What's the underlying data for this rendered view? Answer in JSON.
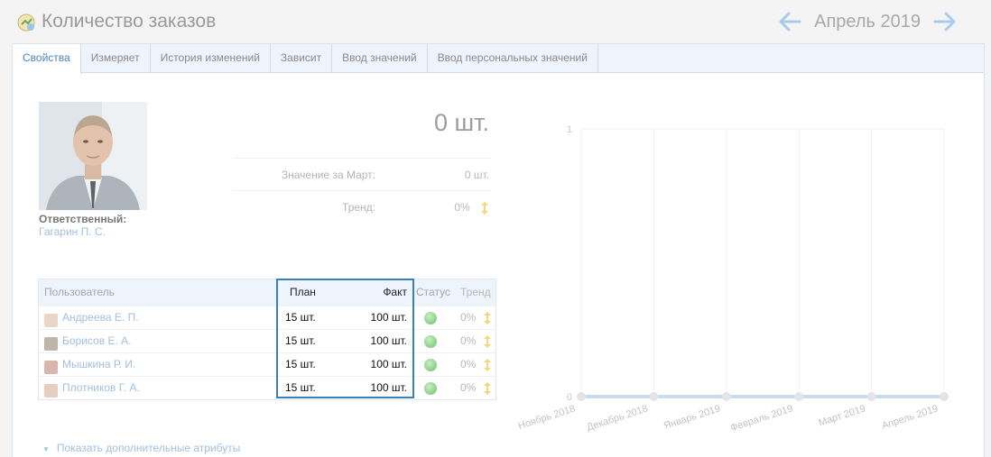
{
  "header": {
    "title": "Количество заказов",
    "month": "Апрель 2019"
  },
  "tabs": [
    {
      "label": "Свойства",
      "active": true
    },
    {
      "label": "Измеряет",
      "active": false
    },
    {
      "label": "История изменений",
      "active": false
    },
    {
      "label": "Зависит",
      "active": false
    },
    {
      "label": "Ввод значений",
      "active": false
    },
    {
      "label": "Ввод персональных значений",
      "active": false
    }
  ],
  "responsible": {
    "label": "Ответственный:",
    "name": "Гагарин П. С."
  },
  "kpi": {
    "value": "0 шт.",
    "prev_label": "Значение за Март:",
    "prev_value": "0 шт.",
    "trend_label": "Тренд:",
    "trend_value": "0%"
  },
  "users_table": {
    "headers": {
      "user": "Пользователь",
      "plan": "План",
      "fact": "Факт",
      "status": "Статус",
      "trend": "Тренд"
    },
    "rows": [
      {
        "user": "Андреева Е. П.",
        "plan": "15 шт.",
        "fact": "100 шт.",
        "trend": "0%"
      },
      {
        "user": "Борисов Е. А.",
        "plan": "15 шт.",
        "fact": "100 шт.",
        "trend": "0%"
      },
      {
        "user": "Мышкина Р. И.",
        "plan": "15 шт.",
        "fact": "100 шт.",
        "trend": "0%"
      },
      {
        "user": "Плотников Г. А.",
        "plan": "15 шт.",
        "fact": "100 шт.",
        "trend": "0%"
      }
    ]
  },
  "more_link": "Показать дополнительные атрибуты",
  "colors": {
    "accent": "#4b83c4",
    "highlight_border": "#3b7fb8",
    "status_ok": "#6cbf6c",
    "trend": "#f5c842"
  },
  "chart_data": {
    "type": "line",
    "categories": [
      "Ноябрь 2018",
      "Декабрь 2018",
      "Январь 2019",
      "Февраль 2019",
      "Март 2019",
      "Апрель 2019"
    ],
    "values": [
      0,
      0,
      0,
      0,
      0,
      0
    ],
    "ylim": [
      0,
      1
    ],
    "y_ticks": [
      "0",
      "1"
    ],
    "grid": true
  }
}
